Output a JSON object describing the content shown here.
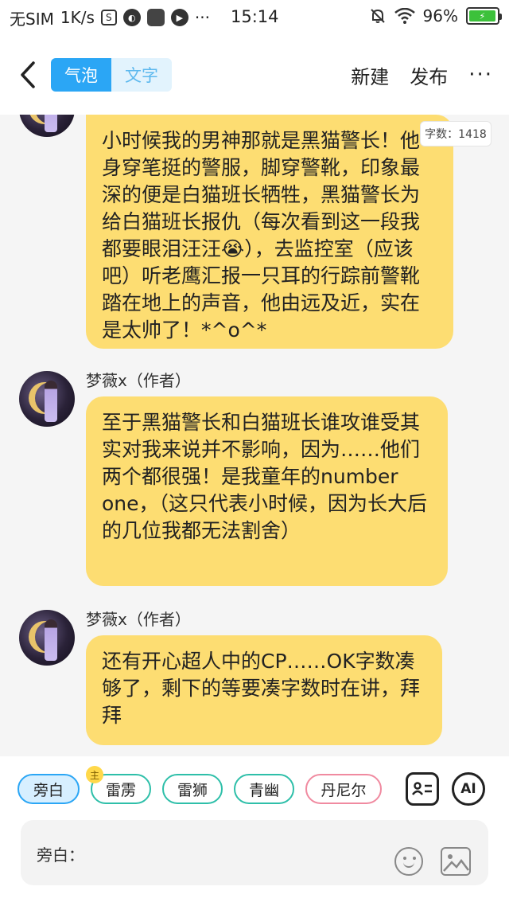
{
  "status_bar": {
    "carrier": "无SIM",
    "speed": "1K/s",
    "time": "15:14",
    "battery": "96%",
    "icons": [
      "s-box-icon",
      "game-icon",
      "app-square-icon",
      "play-icon",
      "more-dots-icon",
      "bell-off-icon",
      "wifi-icon",
      "battery-icon"
    ]
  },
  "header": {
    "tabs": [
      {
        "label": "气泡",
        "active": true
      },
      {
        "label": "文字",
        "active": false
      }
    ],
    "new_label": "新建",
    "publish_label": "发布",
    "more_label": "···"
  },
  "word_count": "字数：1418",
  "messages": [
    {
      "author": "",
      "text": "小时候我的男神那就是黑猫警长！他身穿笔挺的警服，脚穿警靴，印象最深的便是白猫班长牺牲，黑猫警长为给白猫班长报仇（每次看到这一段我都要眼泪汪汪😭），去监控室（应该吧）听老鹰汇报一只耳的行踪前警靴踏在地上的声音，他由远及近，实在是太帅了！*^o^*"
    },
    {
      "author": "梦薇x（作者）",
      "text": "至于黑猫警长和白猫班长谁攻谁受其实对我来说并不影响，因为……他们两个都很强！是我童年的number one，（这只代表小时候，因为长大后的几位我都无法割舍）"
    },
    {
      "author": "梦薇x（作者）",
      "text": "还有开心超人中的CP……OK字数凑够了，剩下的等要凑字数时在讲，拜拜"
    }
  ],
  "characters": [
    {
      "label": "旁白",
      "selected": true
    },
    {
      "label": "雷雳",
      "badge": "主"
    },
    {
      "label": "雷狮"
    },
    {
      "label": "青幽"
    },
    {
      "label": "丹尼尔"
    }
  ],
  "tools": {
    "ai_label": "AI"
  },
  "input": {
    "label": "旁白："
  },
  "colors": {
    "accent": "#2ba6f5",
    "bubble": "#fddd72",
    "chip_border": "#2ebfa9",
    "chip_pink": "#f08aa0"
  }
}
